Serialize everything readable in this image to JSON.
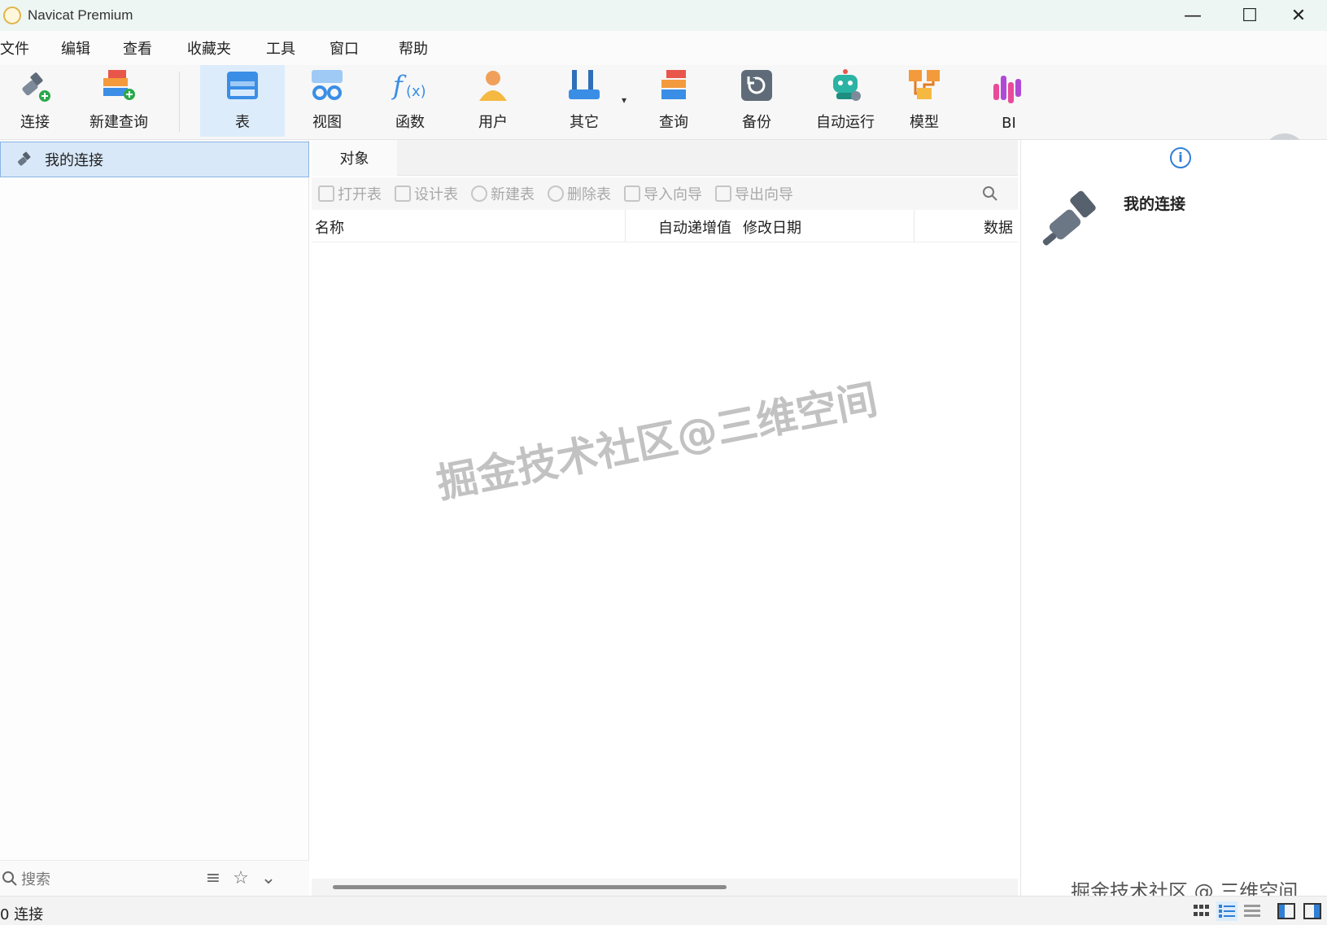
{
  "window": {
    "title": "Navicat Premium",
    "minimize": "—",
    "maximize": "☐",
    "close": "✕"
  },
  "menu": [
    "文件",
    "编辑",
    "查看",
    "收藏夹",
    "工具",
    "窗口",
    "帮助"
  ],
  "toolbar": {
    "connect": "连接",
    "new_query": "新建查询",
    "table": "表",
    "view": "视图",
    "function": "函数",
    "user": "用户",
    "other": "其它",
    "query": "查询",
    "backup": "备份",
    "automation": "自动运行",
    "model": "模型",
    "bi": "BI"
  },
  "sidebar": {
    "connection_label": "我的连接",
    "search_placeholder": "搜索"
  },
  "objects": {
    "tab_label": "对象",
    "actions": [
      "打开表",
      "设计表",
      "新建表",
      "删除表",
      "导入向导",
      "导出向导"
    ],
    "columns": [
      "名称",
      "自动递增值",
      "修改日期",
      "数据"
    ]
  },
  "info_panel": {
    "title": "我的连接"
  },
  "status": {
    "connections": "0 连接"
  },
  "watermark": {
    "center": "掘金技术社区@三维空间",
    "corner": "掘金技术社区 @ 三维空间"
  },
  "colors": {
    "accent": "#2f7fd6",
    "selected_bg": "#d8e8f8",
    "active_tool": "#dcecfb"
  }
}
